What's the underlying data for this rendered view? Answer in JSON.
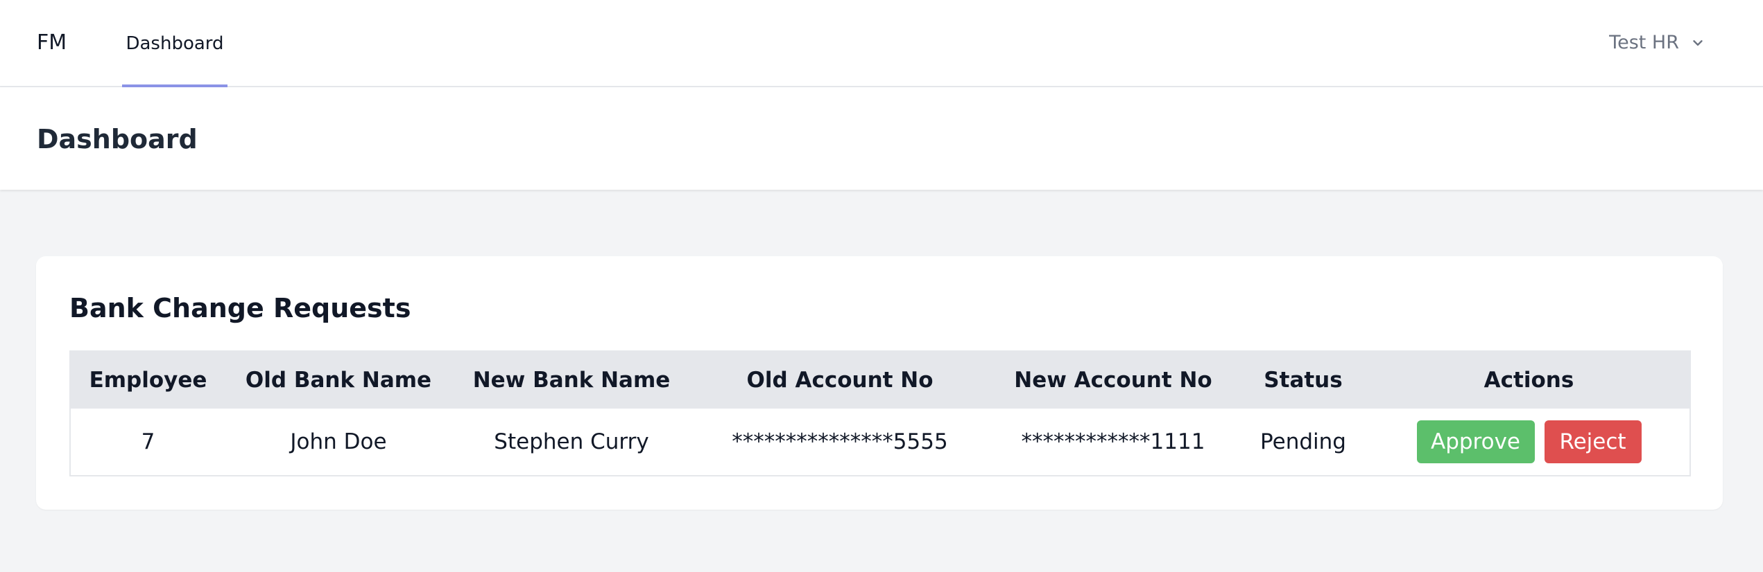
{
  "nav": {
    "brand": "FM",
    "tabs": [
      {
        "label": "Dashboard",
        "active": true
      }
    ],
    "user": {
      "name": "Test HR",
      "icon": "chevron-down-icon"
    }
  },
  "header": {
    "title": "Dashboard"
  },
  "card": {
    "title": "Bank Change Requests",
    "table": {
      "columns": [
        "Employee",
        "Old Bank Name",
        "New Bank Name",
        "Old Account No",
        "New Account No",
        "Status",
        "Actions"
      ],
      "rows": [
        {
          "employee": "7",
          "old_bank_name": "John Doe",
          "new_bank_name": "Stephen Curry",
          "old_account_no": "***************5555",
          "new_account_no": "************1111",
          "status": "Pending",
          "approve_label": "Approve",
          "reject_label": "Reject"
        }
      ]
    }
  },
  "colors": {
    "accent": "#8b93e6",
    "approve": "#5cbf6b",
    "reject": "#df4f4f",
    "background": "#f3f4f6"
  }
}
